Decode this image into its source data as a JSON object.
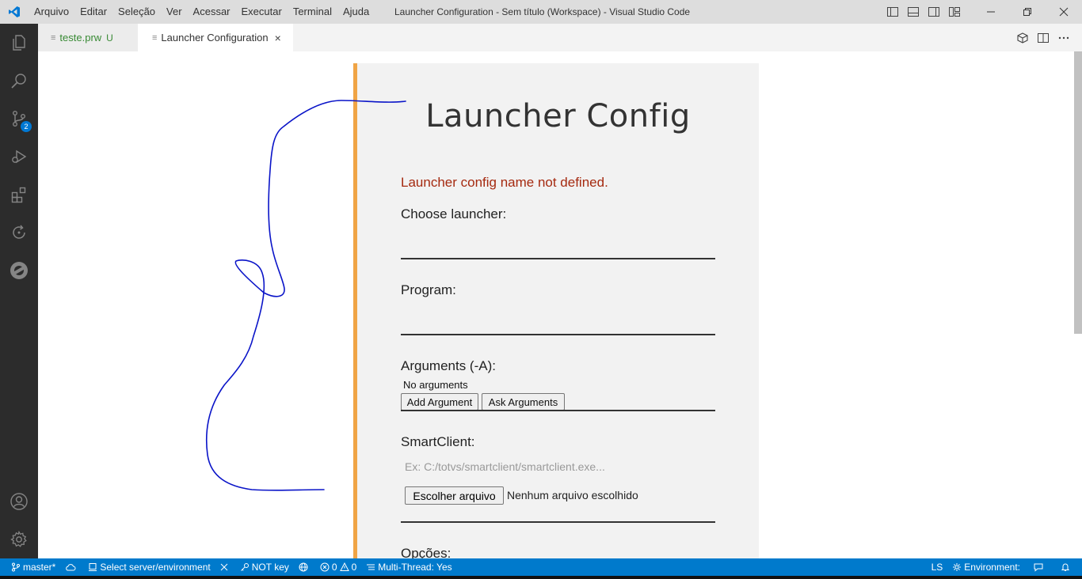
{
  "menu": [
    "Arquivo",
    "Editar",
    "Seleção",
    "Ver",
    "Acessar",
    "Executar",
    "Terminal",
    "Ajuda"
  ],
  "window_title": "Launcher Configuration - Sem título (Workspace) - Visual Studio Code",
  "activity_bar": {
    "source_control_badge": "2"
  },
  "tabs": [
    {
      "label": "teste.prw",
      "status": "U"
    },
    {
      "label": "Launcher Configuration",
      "close": "×"
    }
  ],
  "launcher": {
    "title": "Launcher Config",
    "error": "Launcher config name not defined.",
    "choose_launcher_label": "Choose launcher:",
    "program_label": "Program:",
    "arguments_label": "Arguments (-A):",
    "no_arguments": "No arguments",
    "add_argument": "Add Argument",
    "ask_arguments": "Ask Arguments",
    "smartclient_label": "SmartClient:",
    "smartclient_placeholder": "Ex: C:/totvs/smartclient/smartclient.exe...",
    "choose_file": "Escolher arquivo",
    "no_file": "Nenhum arquivo escolhido",
    "options_label": "Opções:"
  },
  "statusbar": {
    "branch": "master*",
    "server": "Select server/environment",
    "key": "NOT key",
    "errors": "0",
    "warnings": "0",
    "multithread": "Multi-Thread: Yes",
    "ls": "LS",
    "environment": "Environment:"
  },
  "colors": {
    "accent": "#007acc",
    "panel_border": "#f0a445",
    "error": "#a52a10",
    "ink": "#0a14c8"
  }
}
